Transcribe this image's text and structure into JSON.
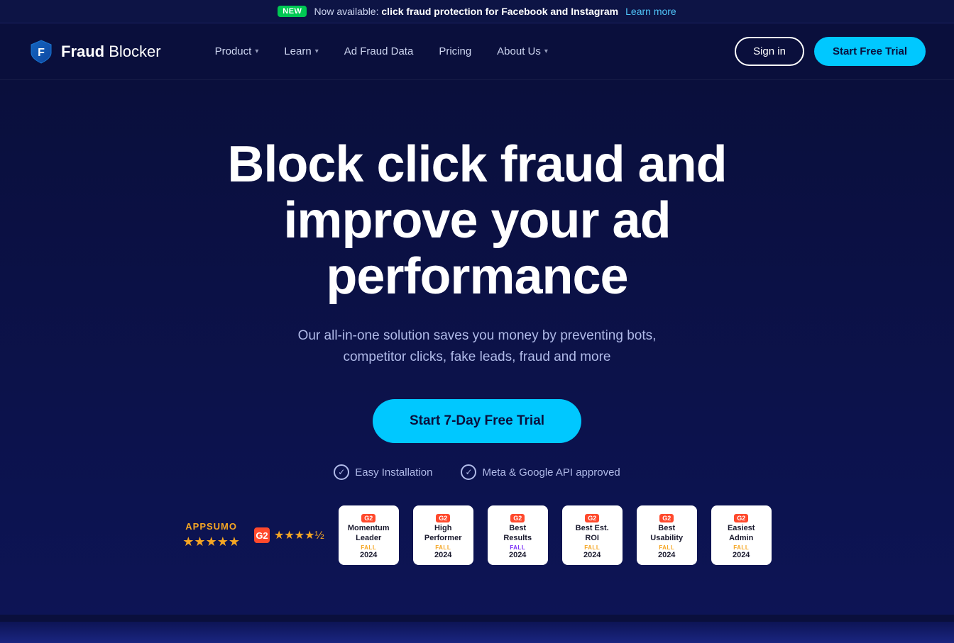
{
  "announcement": {
    "badge": "NEW",
    "text_prefix": "Now available:",
    "text_highlight": "click fraud protection for Facebook and Instagram",
    "learn_more": "Learn more"
  },
  "nav": {
    "logo_text_normal": "Fraud",
    "logo_text_bold": " Blocker",
    "links": [
      {
        "label": "Product",
        "has_dropdown": true
      },
      {
        "label": "Learn",
        "has_dropdown": true
      },
      {
        "label": "Ad Fraud Data",
        "has_dropdown": false
      },
      {
        "label": "Pricing",
        "has_dropdown": false
      },
      {
        "label": "About Us",
        "has_dropdown": true
      }
    ],
    "signin_label": "Sign in",
    "trial_label": "Start Free Trial"
  },
  "hero": {
    "heading_line1": "Block click fraud and",
    "heading_line2": "improve your ad performance",
    "subtext": "Our all-in-one solution saves you money by preventing bots, competitor clicks, fake leads, fraud and more",
    "cta_label": "Start 7-Day Free Trial",
    "trust_items": [
      {
        "text": "Easy Installation"
      },
      {
        "text": "Meta & Google API approved"
      }
    ]
  },
  "badges": {
    "appsumo_label": "APPSUMO",
    "stars_count": 5,
    "g2_label": "G2",
    "g2_stars": 4.5,
    "items": [
      {
        "id": "momentum",
        "g2_tag": "G2",
        "title": "Momentum Leader",
        "season": "FALL",
        "year": "2024",
        "season_class": "badge-momentum"
      },
      {
        "id": "high",
        "g2_tag": "G2",
        "title": "High Performer",
        "season": "FALL",
        "year": "2024",
        "season_class": "badge-high"
      },
      {
        "id": "best-results",
        "g2_tag": "G2",
        "title": "Best Results",
        "season": "FALL",
        "year": "2024",
        "season_class": "badge-best-results"
      },
      {
        "id": "roi",
        "g2_tag": "G2",
        "title": "Best Est. ROI",
        "season": "FALL",
        "year": "2024",
        "season_class": "badge-roi"
      },
      {
        "id": "usability",
        "g2_tag": "G2",
        "title": "Best Usability",
        "season": "FALL",
        "year": "2024",
        "season_class": "badge-usability"
      },
      {
        "id": "admin",
        "g2_tag": "G2",
        "title": "Easiest Admin",
        "season": "FALL",
        "year": "2024",
        "season_class": "badge-admin"
      }
    ]
  },
  "colors": {
    "accent_cyan": "#00c8ff",
    "accent_green": "#00c853",
    "nav_bg": "#0a0f3c",
    "g2_red": "#ff492c"
  }
}
